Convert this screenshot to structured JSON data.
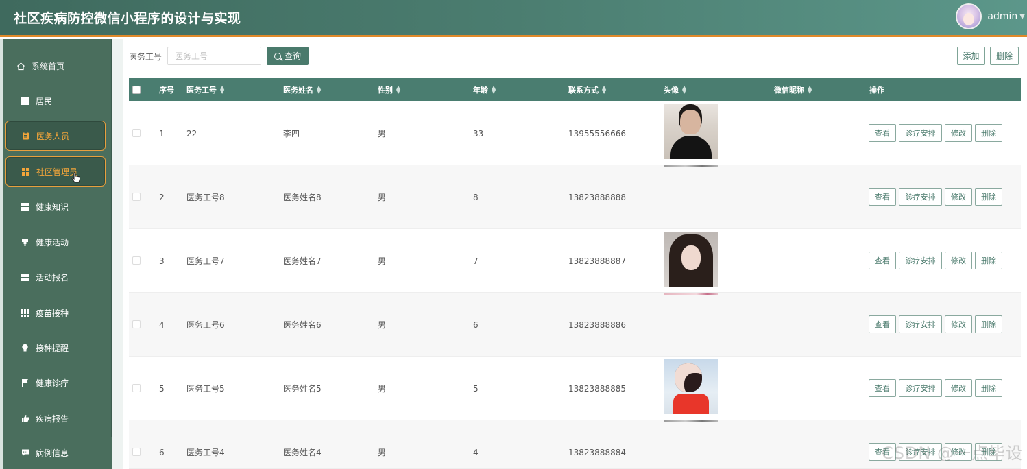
{
  "header": {
    "title": "社区疾病防控微信小程序的设计与实现",
    "username": "admin"
  },
  "sidebar": {
    "items": [
      {
        "label": "系统首页",
        "icon": "home-icon"
      },
      {
        "label": "居民",
        "icon": "grid-icon"
      },
      {
        "label": "医务人员",
        "icon": "clipboard-icon",
        "state": "active"
      },
      {
        "label": "社区管理员",
        "icon": "grid-icon",
        "state": "active-hover"
      },
      {
        "label": "健康知识",
        "icon": "grid-icon"
      },
      {
        "label": "健康活动",
        "icon": "cup-icon"
      },
      {
        "label": "活动报名",
        "icon": "grid-icon"
      },
      {
        "label": "疫苗接种",
        "icon": "apps-icon"
      },
      {
        "label": "接种提醒",
        "icon": "bulb-icon"
      },
      {
        "label": "健康诊疗",
        "icon": "flag-icon"
      },
      {
        "label": "疾病报告",
        "icon": "thumb-icon"
      },
      {
        "label": "病例信息",
        "icon": "chat-icon"
      }
    ]
  },
  "search": {
    "label": "医务工号",
    "placeholder": "医务工号",
    "button": "查询"
  },
  "actions": {
    "add": "添加",
    "delete": "删除"
  },
  "table": {
    "columns": [
      "序号",
      "医务工号",
      "医务姓名",
      "性别",
      "年龄",
      "联系方式",
      "头像",
      "微信昵称",
      "操作"
    ],
    "rows": [
      {
        "no": "1",
        "id": "22",
        "name": "李四",
        "gender": "男",
        "age": "33",
        "phone": "13955556666",
        "avatar": "photo-man",
        "nickname": ""
      },
      {
        "no": "2",
        "id": "医务工号8",
        "name": "医务姓名8",
        "gender": "男",
        "age": "8",
        "phone": "13823888888",
        "avatar": "",
        "nickname": ""
      },
      {
        "no": "3",
        "id": "医务工号7",
        "name": "医务姓名7",
        "gender": "男",
        "age": "7",
        "phone": "13823888887",
        "avatar": "photo-woman",
        "nickname": ""
      },
      {
        "no": "4",
        "id": "医务工号6",
        "name": "医务姓名6",
        "gender": "男",
        "age": "6",
        "phone": "13823888886",
        "avatar": "",
        "nickname": ""
      },
      {
        "no": "5",
        "id": "医务工号5",
        "name": "医务姓名5",
        "gender": "男",
        "age": "5",
        "phone": "13823888885",
        "avatar": "photo-woman-red",
        "nickname": ""
      },
      {
        "no": "6",
        "id": "医务工号4",
        "name": "医务姓名4",
        "gender": "男",
        "age": "4",
        "phone": "13823888884",
        "avatar": "",
        "nickname": ""
      }
    ],
    "row_actions": [
      "查看",
      "诊疗安排",
      "修改",
      "删除"
    ]
  },
  "watermark": "CSDN @一点毕设"
}
